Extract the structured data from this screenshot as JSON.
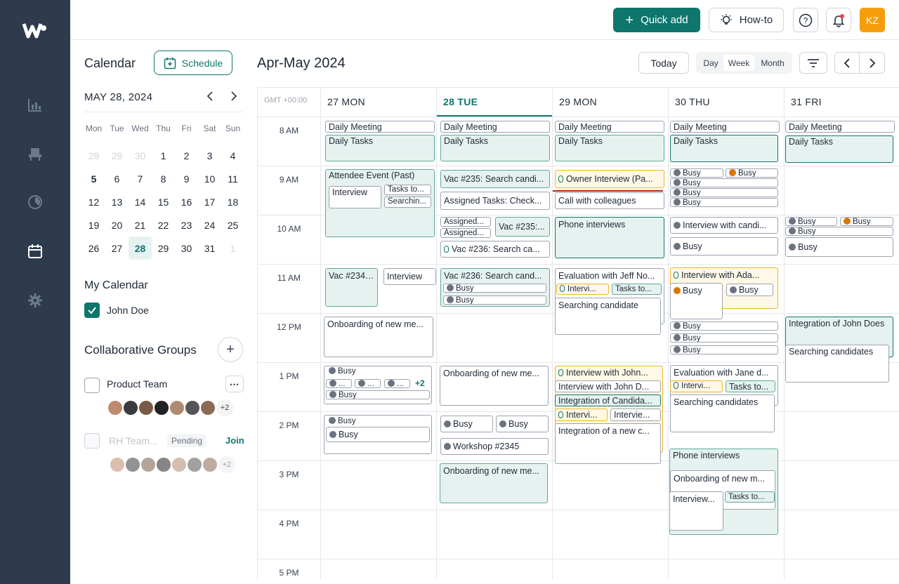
{
  "topbar": {
    "quick_add": "Quick add",
    "how_to": "How-to",
    "user_initials": "KZ"
  },
  "left": {
    "title": "Calendar",
    "schedule": "Schedule",
    "mini_title": "MAY 28, 2024",
    "weekdays": [
      "Mon",
      "Tue",
      "Wed",
      "Thu",
      "Fri",
      "Sat",
      "Sun"
    ],
    "days": [
      [
        "28",
        "29",
        "30",
        "1",
        "2",
        "3",
        "4"
      ],
      [
        "5",
        "6",
        "7",
        "8",
        "9",
        "10",
        "11"
      ],
      [
        "12",
        "13",
        "14",
        "15",
        "16",
        "17",
        "18"
      ],
      [
        "19",
        "20",
        "21",
        "22",
        "23",
        "24",
        "25"
      ],
      [
        "26",
        "27",
        "28",
        "29",
        "30",
        "31",
        "1"
      ]
    ],
    "my_calendar": "My Calendar",
    "john": "John Doe",
    "collab": "Collaborative Groups",
    "product_team": "Product Team",
    "plus_count": "+2",
    "rh_team": "RH Team...",
    "pending": "Pending",
    "join": "Join"
  },
  "header": {
    "range": "Apr-May 2024",
    "today": "Today",
    "day": "Day",
    "week": "Week",
    "month": "Month"
  },
  "grid": {
    "gmt": "GMT +00:00",
    "days": [
      "27 MON",
      "28 TUE",
      "29 MON",
      "30 THU",
      "31 FRI"
    ],
    "hours": [
      "8 AM",
      "9 AM",
      "10 AM",
      "11 AM",
      "12 PM",
      "1 PM",
      "2 PM",
      "3 PM",
      "4 PM",
      "5 PM"
    ]
  },
  "events": {
    "daily_meeting": "Daily Meeting",
    "daily_tasks": "Daily Tasks",
    "attendee_event": "Attendee Event (Past)",
    "interview": "Interview",
    "tasks_to": "Tasks to...",
    "searchin": "Searchin...",
    "vac235": "Vac #235: Search candi...",
    "assigned_tasks": "Assigned Tasks: Check...",
    "assigned1": "Assigned...",
    "assigned2": "Assigned...",
    "vac235b": "Vac #235:...",
    "vac236": "Vac #236: Search ca...",
    "owner_interview": "Owner Interview (Pa...",
    "call_colleagues": "Call with colleagues",
    "phone_interviews": "Phone interviews",
    "busy": "Busy",
    "interview_candi": "Interview with candi...",
    "vac234": "Vac #234:...",
    "vac236b": "Vac #236: Search cand...",
    "eval_jeff": "Evaluation with Jeff No...",
    "intervi": "Intervi...",
    "tasks_to2": "Tasks to...",
    "searching_candidate": "Searching candidate",
    "interview_ada": "Interview with Ada...",
    "onboarding": "Onboarding of new me...",
    "integration_john": "Integration of John Does",
    "searching_candidates": "Searching candidates",
    "plus2": "+2",
    "ellipsis": "...",
    "interview_john": "Interview with John...",
    "interview_john_d": "Interview with John D...",
    "integration_candi": "Integration of Candida...",
    "intervie": "Intervie...",
    "integration_new": "Integration of a new c...",
    "eval_jane": "Evaluation with Jane d...",
    "workshop": "Workshop #2345",
    "onboarding_new": "Onboarding of new m...",
    "interview_dots": "Interview..."
  }
}
